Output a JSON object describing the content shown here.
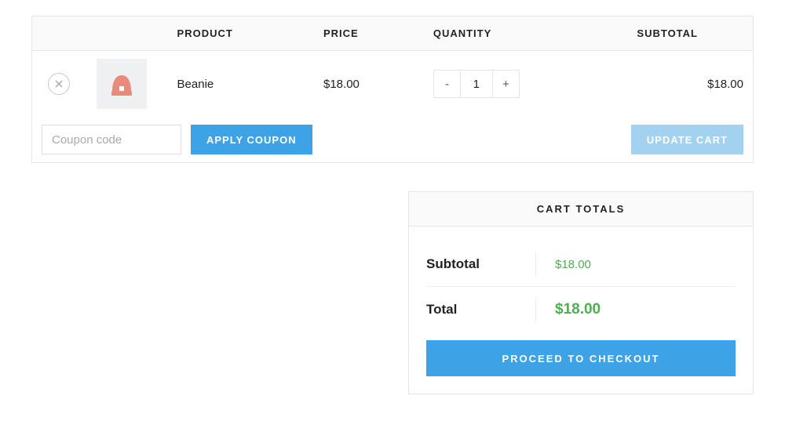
{
  "headers": {
    "product": "PRODUCT",
    "price": "PRICE",
    "quantity": "QUANTITY",
    "subtotal": "SUBTOTAL"
  },
  "item": {
    "name": "Beanie",
    "price": "$18.00",
    "quantity": "1",
    "subtotal": "$18.00",
    "decrement": "-",
    "increment": "+"
  },
  "coupon": {
    "placeholder": "Coupon code",
    "apply": "APPLY COUPON"
  },
  "update_cart": "UPDATE CART",
  "totals": {
    "title": "CART TOTALS",
    "subtotal_label": "Subtotal",
    "subtotal_value": "$18.00",
    "total_label": "Total",
    "total_value": "$18.00",
    "checkout": "PROCEED TO CHECKOUT"
  }
}
